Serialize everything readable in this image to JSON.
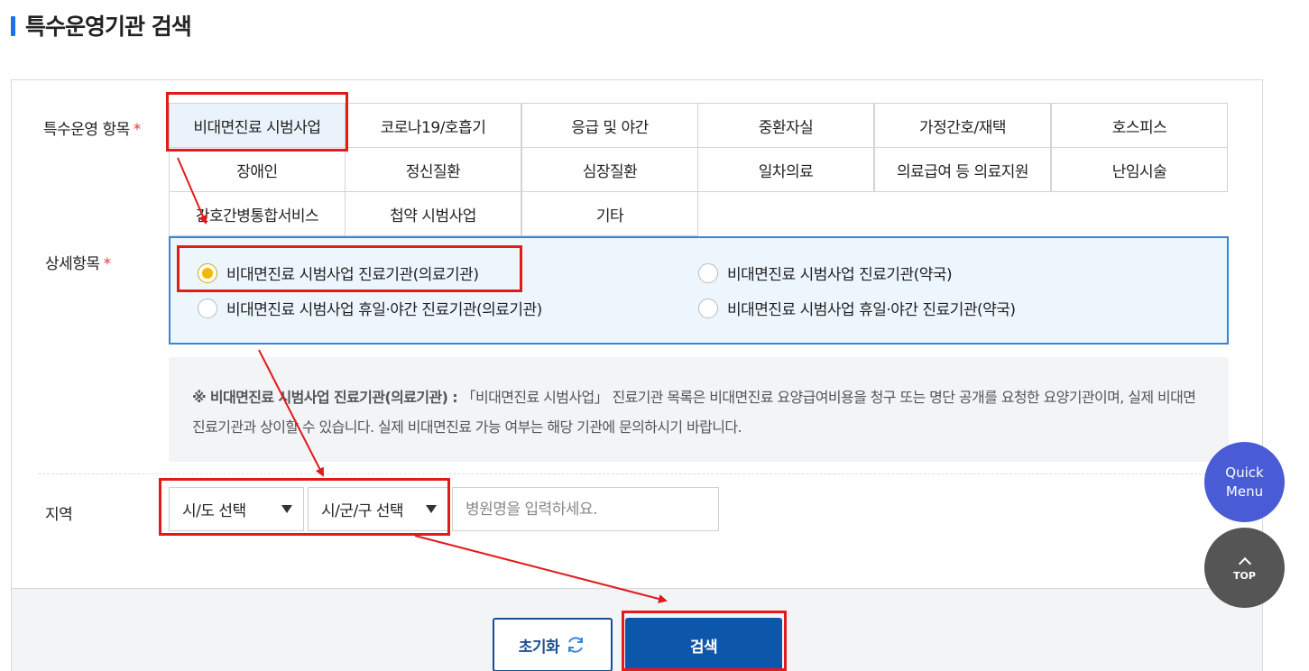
{
  "page": {
    "title": "특수운영기관 검색"
  },
  "labels": {
    "special_items": "특수운영 항목",
    "detail_items": "상세항목",
    "region": "지역",
    "required_mark": "*"
  },
  "categories": [
    "비대면진료 시범사업",
    "코로나19/호흡기",
    "응급 및 야간",
    "중환자실",
    "가정간호/재택",
    "호스피스",
    "장애인",
    "정신질환",
    "심장질환",
    "일차의료",
    "의료급여 등 의료지원",
    "난임시술",
    "간호간병통합서비스",
    "첩약 시범사업",
    "기타"
  ],
  "selected_category": "비대면진료 시범사업",
  "detail_options": [
    {
      "label": "비대면진료 시범사업 진료기관(의료기관)",
      "checked": true
    },
    {
      "label": "비대면진료 시범사업 진료기관(약국)",
      "checked": false
    },
    {
      "label": "비대면진료 시범사업 휴일·야간 진료기관(의료기관)",
      "checked": false
    },
    {
      "label": "비대면진료 시범사업 휴일·야간 진료기관(약국)",
      "checked": false
    }
  ],
  "note": {
    "bold": "※ 비대면진료 시범사업 진료기관(의료기관) :",
    "text": " 「비대면진료 시범사업」 진료기관 목록은 비대면진료 요양급여비용을 청구 또는 명단 공개를 요청한 요양기관이며, 실제 비대면 진료기관과 상이할 수 있습니다. 실제 비대면진료 가능 여부는 해당 기관에 문의하시기 바랍니다."
  },
  "region": {
    "province_select": "시/도 선택",
    "district_select": "시/군/구 선택",
    "hospital_name_placeholder": "병원명을 입력하세요.",
    "hospital_name_value": ""
  },
  "buttons": {
    "reset": "초기화",
    "search": "검색"
  },
  "floating": {
    "quick_menu_line1": "Quick",
    "quick_menu_line2": "Menu",
    "top": "TOP"
  },
  "colors": {
    "accent_blue": "#0d57ab",
    "highlight_red": "#e01b1b",
    "radio_selected": "#f5b800",
    "detail_border": "#3a86d6"
  }
}
